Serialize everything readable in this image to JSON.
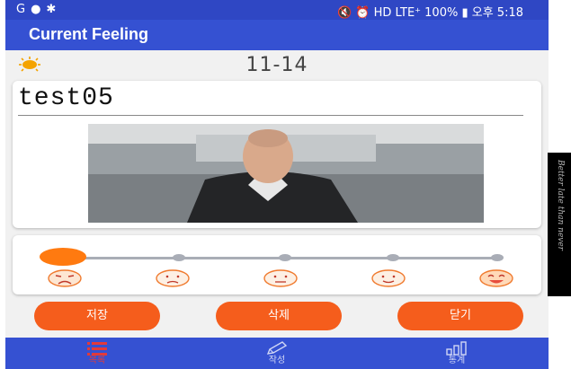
{
  "status_bar": {
    "left_icons": [
      "app-icon",
      "chat-icon",
      "bug-icon"
    ],
    "right_text": "🔇 ⏰ HD LTE⁺ 100% ▮ 오후 5:18"
  },
  "app_bar": {
    "title": "Current Feeling"
  },
  "entry": {
    "weather_icon": "sun-icon",
    "date": "11-14",
    "title": "test05"
  },
  "mood": {
    "levels": 5,
    "selected_index": 0,
    "face_icons": [
      "face-1-icon",
      "face-2-icon",
      "face-3-icon",
      "face-4-icon",
      "face-5-icon"
    ]
  },
  "actions": {
    "save_label": "저장",
    "delete_label": "삭제",
    "close_label": "닫기"
  },
  "bottom_nav": {
    "list_label": "목록",
    "write_label": "작성",
    "stats_label": "통계",
    "active": "list"
  },
  "side_text": "Better late than never",
  "colors": {
    "app_bar": "#3551d2",
    "accent": "#f55d1c",
    "slider_thumb": "#ff7a10"
  }
}
